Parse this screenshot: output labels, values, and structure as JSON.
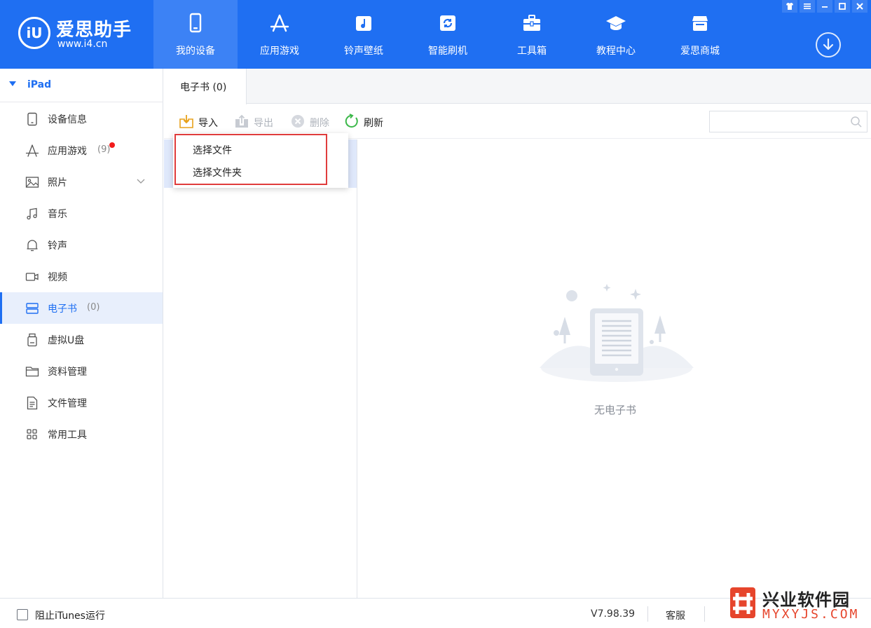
{
  "app": {
    "logo_mark": "iU",
    "logo_title": "爱思助手",
    "logo_url": "www.i4.cn"
  },
  "nav": [
    {
      "label": "我的设备",
      "icon": "phone-icon",
      "active": true
    },
    {
      "label": "应用游戏",
      "icon": "app-store-icon",
      "active": false
    },
    {
      "label": "铃声壁纸",
      "icon": "music-note-icon",
      "active": false
    },
    {
      "label": "智能刷机",
      "icon": "refresh-icon",
      "active": false
    },
    {
      "label": "工具箱",
      "icon": "toolbox-icon",
      "active": false
    },
    {
      "label": "教程中心",
      "icon": "graduation-cap-icon",
      "active": false
    },
    {
      "label": "爱思商城",
      "icon": "store-icon",
      "active": false
    }
  ],
  "window_controls": [
    "shirt-icon",
    "menu-icon",
    "minimize-icon",
    "maximize-icon",
    "close-icon"
  ],
  "sidebar": {
    "device_name": "iPad",
    "items": [
      {
        "label": "设备信息",
        "icon": "tablet-icon",
        "count": ""
      },
      {
        "label": "应用游戏",
        "icon": "app-store-icon",
        "count": "(9)",
        "badge": true
      },
      {
        "label": "照片",
        "icon": "image-icon",
        "count": "",
        "expandable": true
      },
      {
        "label": "音乐",
        "icon": "music-note-icon",
        "count": ""
      },
      {
        "label": "铃声",
        "icon": "bell-icon",
        "count": ""
      },
      {
        "label": "视频",
        "icon": "video-camera-icon",
        "count": ""
      },
      {
        "label": "电子书",
        "icon": "book-icon",
        "count": "(0)",
        "active": true
      },
      {
        "label": "虚拟U盘",
        "icon": "usb-drive-icon",
        "count": ""
      },
      {
        "label": "资料管理",
        "icon": "folder-icon",
        "count": ""
      },
      {
        "label": "文件管理",
        "icon": "document-icon",
        "count": ""
      },
      {
        "label": "常用工具",
        "icon": "grid-icon",
        "count": ""
      }
    ]
  },
  "tabs": [
    {
      "label": "电子书 (0)",
      "active": true
    }
  ],
  "toolbar": {
    "import_label": "导入",
    "export_label": "导出",
    "delete_label": "删除",
    "refresh_label": "刷新"
  },
  "search": {
    "placeholder": "",
    "value": ""
  },
  "import_menu": {
    "items": [
      "选择文件",
      "选择文件夹"
    ]
  },
  "empty_state": {
    "text": "无电子书"
  },
  "statusbar": {
    "itunes_label": "阻止iTunes运行",
    "itunes_checked": false,
    "version": "V7.98.39",
    "service_label": "客服"
  },
  "watermark": {
    "title": "兴业软件园",
    "url": "MYXYJS.COM"
  },
  "colors": {
    "brand_blue": "#1f6ff2",
    "active_nav": "#3c82f5",
    "sidebar_active_bg": "#e8effc",
    "highlight_red": "#e03c3c",
    "badge_red": "#f21c1c",
    "refresh_green": "#3cb84a",
    "import_yellow": "#f0b322"
  }
}
